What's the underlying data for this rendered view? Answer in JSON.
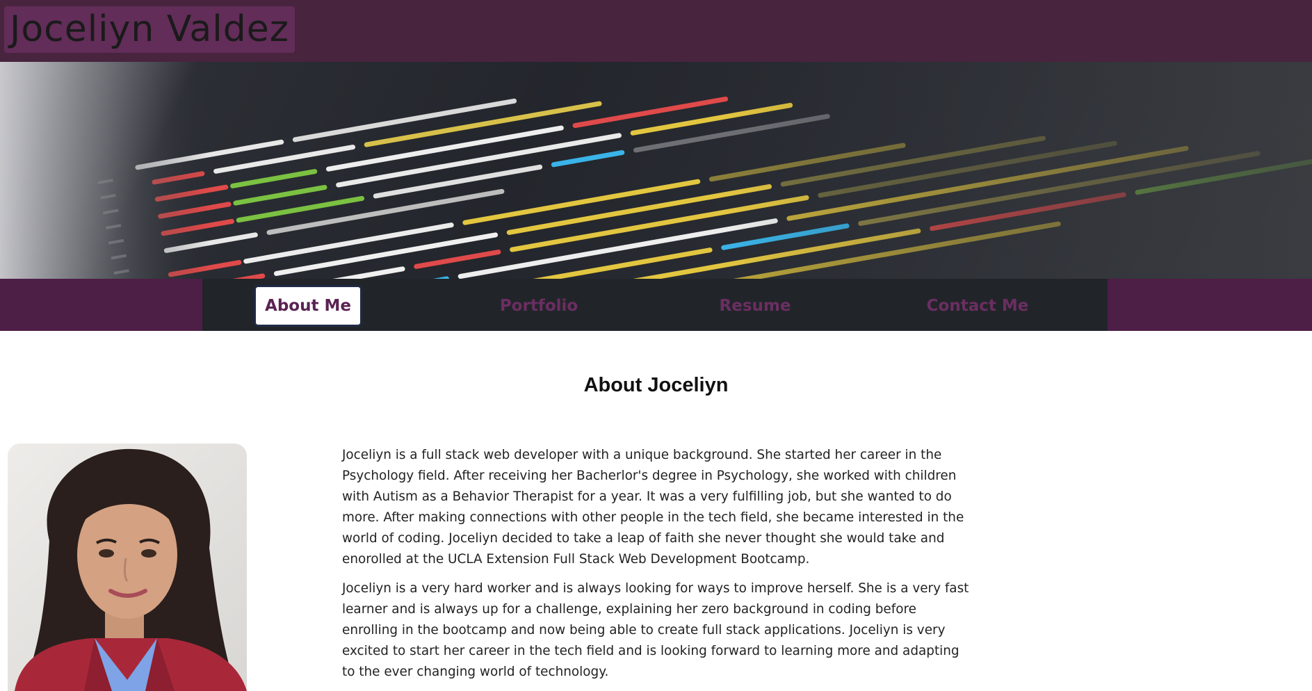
{
  "header": {
    "site_title": "Joceliyn Valdez"
  },
  "nav": {
    "items": [
      {
        "label": "About Me",
        "active": true
      },
      {
        "label": "Portfolio",
        "active": false
      },
      {
        "label": "Resume",
        "active": false
      },
      {
        "label": "Contact Me",
        "active": false
      }
    ]
  },
  "about": {
    "heading": "About Joceliyn",
    "paragraphs": [
      "Joceliyn is a full stack web developer with a unique background. She started her career in the Psychology field. After receiving her Bacherlor's degree in Psychology, she worked with children with Autism as a Behavior Therapist for a year. It was a very fulfilling job, but she wanted to do more. After making connections with other people in the tech field, she became interested in the world of coding. Joceliyn decided to take a leap of faith she never thought she would take and enorolled at the UCLA Extension Full Stack Web Development Bootcamp.",
      "Joceliyn is a very hard worker and is always looking for ways to improve herself. She is a very fast learner and is always up for a challenge, explaining her zero background in coding before enrolling in the bootcamp and now being able to create full stack applications. Joceliyn is very excited to start her career in the tech field and is looking forward to learning more and adapting to the ever changing world of technology."
    ]
  },
  "colors": {
    "header_bg": "#48243f",
    "title_bg": "#622d58",
    "nav_bg": "#4d1f47",
    "nav_inner_bg": "#212529",
    "nav_link": "#6b2e62"
  }
}
